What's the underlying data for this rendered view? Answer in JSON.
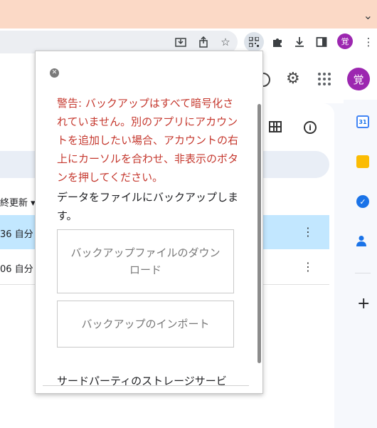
{
  "browser": {
    "profile_initial": "覚",
    "icons": [
      "download-page-icon",
      "share-icon",
      "bookmark-star-icon",
      "qr-extension-icon",
      "puzzle-extensions-icon",
      "downloads-icon",
      "side-panel-icon",
      "kebab-menu-icon"
    ]
  },
  "app": {
    "avatar_initial": "覚",
    "columns": {
      "sort_label": "終更新 ▾"
    },
    "rows": [
      {
        "meta": "36 自分"
      },
      {
        "meta": "06 自分"
      }
    ],
    "side_panel": {
      "calendar_day": "31"
    }
  },
  "popup": {
    "warning": "警告: バックアップはすべて暗号化されていません。別のアプリにアカウントを追加したい場合、アカウントの右上にカーソルを合わせ、非表示のボタンを押してください。",
    "intro": "データをファイルにバックアップします。",
    "download_button": "バックアップファイルのダウンロード",
    "import_button": "バックアップのインポート",
    "storage_text": "サードパーティのストレージサービ"
  },
  "colors": {
    "warning": "#c5382e",
    "accent_profile": "#9c27b0",
    "selected_row": "#c2e7ff",
    "titlebar": "#fbd9c6"
  }
}
